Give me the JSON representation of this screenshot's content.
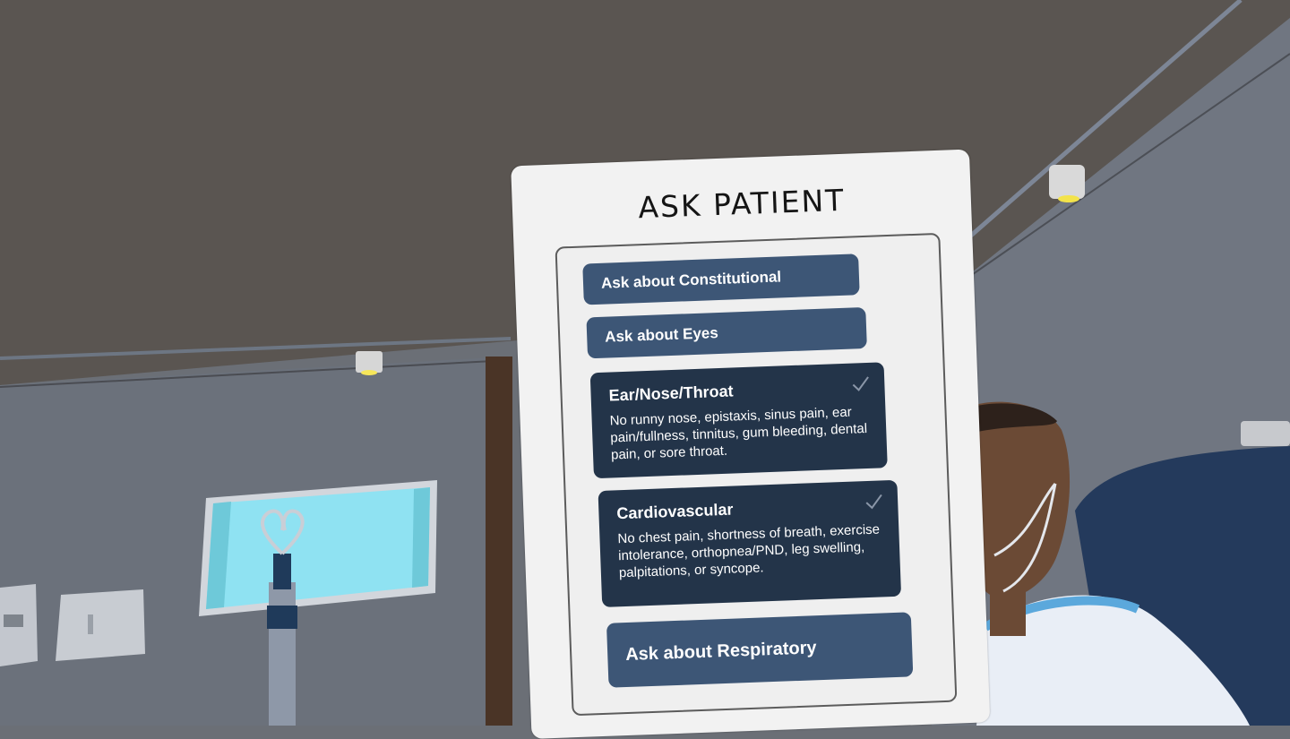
{
  "panel": {
    "title": "ASK PATIENT",
    "items": [
      {
        "label": "Ask about Constitutional",
        "completed": false
      },
      {
        "label": "Ask about Eyes",
        "completed": false
      },
      {
        "label": "Ear/Nose/Throat",
        "completed": true,
        "response": "No runny nose, epistaxis, sinus pain, ear pain/fullness, tinnitus, gum bleeding, dental pain, or sore throat."
      },
      {
        "label": "Cardiovascular",
        "completed": true,
        "response": "No chest pain, shortness of breath, exercise intolerance, orthopnea/PND, leg swelling, palpitations, or syncope."
      },
      {
        "label": "Ask about Respiratory",
        "completed": false
      }
    ]
  },
  "colors": {
    "button": "#3d5676",
    "button_completed": "#233449",
    "panel_bg": "#f2f2f2",
    "ceiling": "#5a5551",
    "wall": "#6e7480"
  },
  "icons": {
    "completed": "checkmark-icon",
    "ceiling_light": "spotlight-icon"
  }
}
